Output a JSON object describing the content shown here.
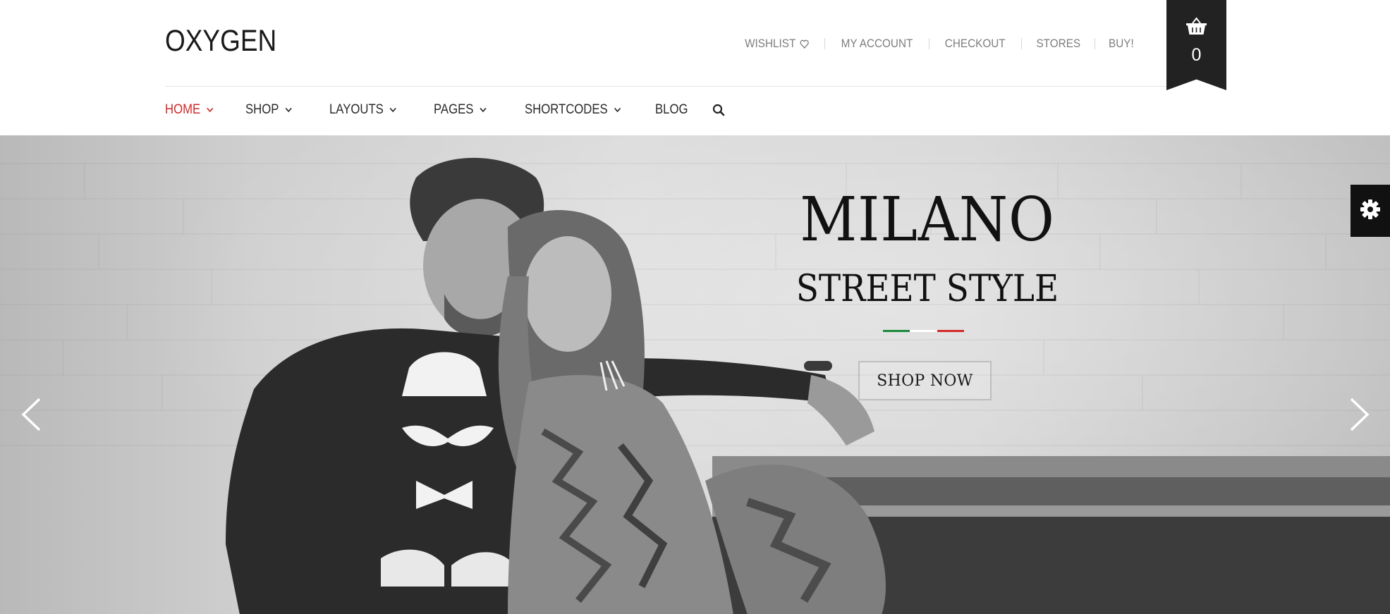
{
  "brand": {
    "logo": "OXYGEN"
  },
  "top_links": [
    {
      "label": "WISHLIST",
      "icon": "heart-icon"
    },
    {
      "label": "MY ACCOUNT"
    },
    {
      "label": "CHECKOUT"
    },
    {
      "label": "STORES"
    },
    {
      "label": "BUY!"
    }
  ],
  "cart": {
    "icon": "basket-icon",
    "count": "0"
  },
  "nav": [
    {
      "label": "HOME",
      "active": true,
      "dropdown": true
    },
    {
      "label": "SHOP",
      "dropdown": true
    },
    {
      "label": "LAYOUTS",
      "dropdown": true
    },
    {
      "label": "PAGES",
      "dropdown": true
    },
    {
      "label": "SHORTCODES",
      "dropdown": true
    },
    {
      "label": "BLOG",
      "dropdown": false
    }
  ],
  "search": {
    "icon": "search-icon"
  },
  "hero": {
    "headline": "MILANO",
    "subheadline": "STREET STYLE",
    "cta_label": "SHOP NOW",
    "flag_colors": [
      "#1a8a3c",
      "#ffffff",
      "#d42a2a"
    ],
    "prev_icon": "chevron-left-icon",
    "next_icon": "chevron-right-icon"
  },
  "settings": {
    "icon": "gear-icon"
  },
  "colors": {
    "accent": "#d12a2a",
    "dark": "#222222"
  }
}
